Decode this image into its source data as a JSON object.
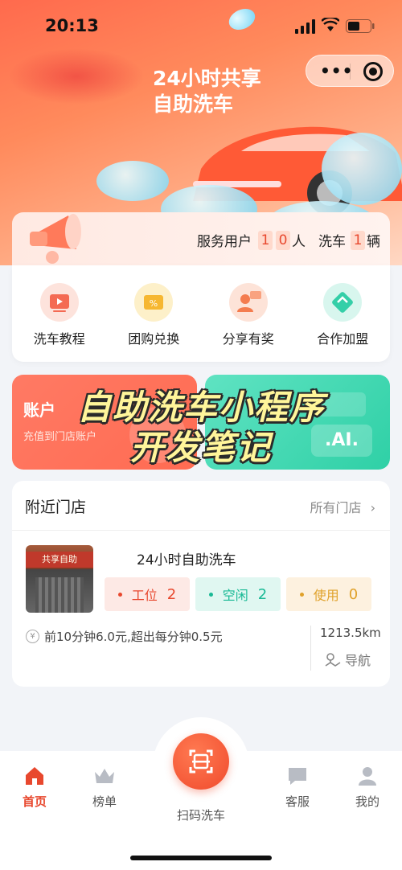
{
  "status_bar": {
    "time": "20:13"
  },
  "hero": {
    "title_line1": "24小时共享",
    "title_line2": "自助洗车"
  },
  "stats": {
    "label_users": "服务用户",
    "users_d1": "1",
    "users_d2": "0",
    "unit_users": "人",
    "label_wash": "洗车",
    "wash_d1": "1",
    "unit_wash": "辆"
  },
  "menu": [
    {
      "label": "洗车教程",
      "icon": "video-tutorial-icon",
      "color": "#f46a53"
    },
    {
      "label": "团购兑换",
      "icon": "coupon-icon",
      "color": "#f6b731"
    },
    {
      "label": "分享有奖",
      "icon": "share-reward-icon",
      "color": "#f47c4f"
    },
    {
      "label": "合作加盟",
      "icon": "handshake-icon",
      "color": "#34cfa8"
    }
  ],
  "promo": {
    "left_title": "账户",
    "left_sub": "充值到门店账户",
    "right_sub": "",
    "right_ai": ".AI."
  },
  "overlay": {
    "line1": "自助洗车小程序",
    "line2": "开发笔记"
  },
  "nearby": {
    "title": "附近门店",
    "all_label": "所有门店",
    "store": {
      "name": "24小时自助洗车",
      "thumb_sign": "共享自助",
      "status": [
        {
          "label": "工位",
          "value": "2",
          "color": "#e8482e",
          "bg": "#fde9e5"
        },
        {
          "label": "空闲",
          "value": "2",
          "color": "#19b995",
          "bg": "#e0f7f1"
        },
        {
          "label": "使用",
          "value": "0",
          "color": "#e0a12a",
          "bg": "#fdf1df"
        }
      ],
      "price": "前10分钟6.0元,超出每分钟0.5元",
      "distance": "1213.5km",
      "nav_label": "导航"
    }
  },
  "tabbar": {
    "home": "首页",
    "rank": "榜单",
    "scan": "扫码洗车",
    "service": "客服",
    "mine": "我的",
    "active_color": "#e8482e"
  }
}
